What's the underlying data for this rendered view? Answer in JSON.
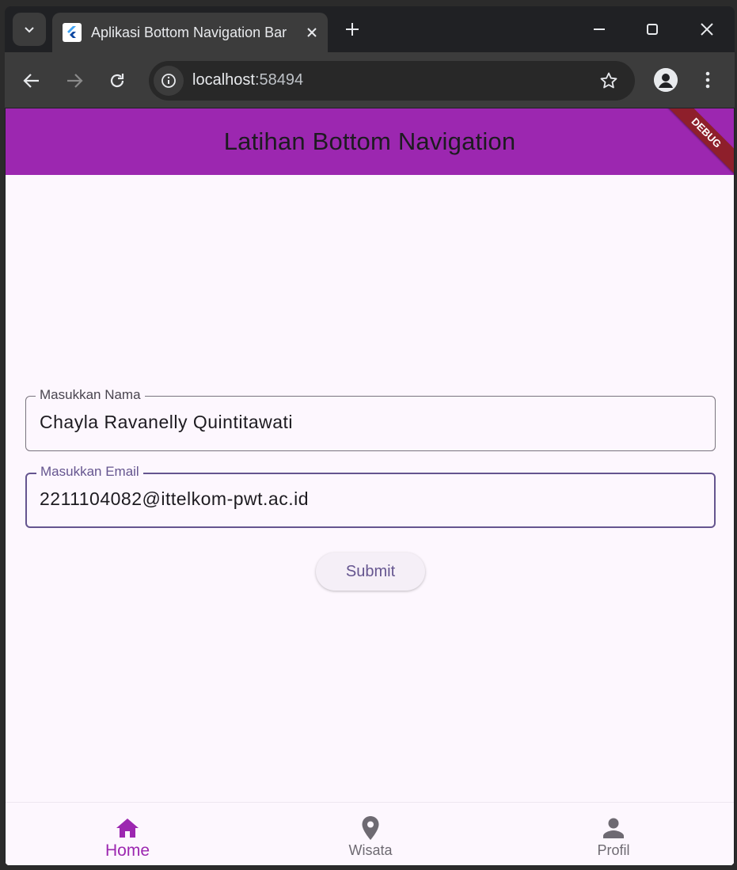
{
  "browser": {
    "tab_title": "Aplikasi Bottom Navigation Bar",
    "url_host": "localhost",
    "url_port": ":58494"
  },
  "app": {
    "title": "Latihan Bottom Navigation",
    "debug_banner": "DEBUG",
    "form": {
      "name_label": "Masukkan Nama",
      "name_value": "Chayla Ravanelly Quintitawati",
      "email_label": "Masukkan Email",
      "email_value": "2211104082@ittelkom-pwt.ac.id",
      "submit_label": "Submit"
    },
    "bottom_nav": {
      "items": [
        {
          "label": "Home",
          "icon": "home-icon",
          "active": true
        },
        {
          "label": "Wisata",
          "icon": "location-pin-icon",
          "active": false
        },
        {
          "label": "Profil",
          "icon": "person-icon",
          "active": false
        }
      ]
    }
  },
  "colors": {
    "appbar": "#9c27b0",
    "accent": "#65558f",
    "active_nav": "#9c27b0",
    "background": "#fdf7fe"
  }
}
